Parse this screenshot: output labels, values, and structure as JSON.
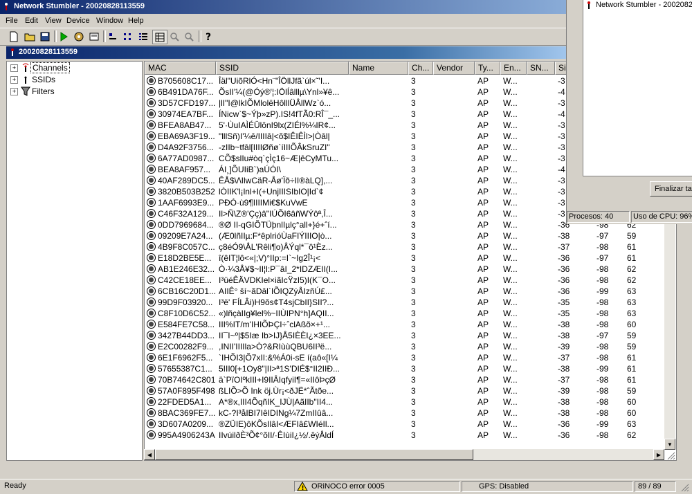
{
  "window": {
    "title": "Network Stumbler - 20020828113559"
  },
  "menu": [
    "File",
    "Edit",
    "View",
    "Device",
    "Window",
    "Help"
  ],
  "child": {
    "title": "20020828113559"
  },
  "tree": [
    {
      "label": "Channels",
      "icon": "antenna-icon",
      "selected": true
    },
    {
      "label": "SSIDs",
      "icon": "antenna-icon",
      "selected": false
    },
    {
      "label": "Filters",
      "icon": "filter-icon",
      "selected": false
    }
  ],
  "columns": [
    "MAC",
    "SSID",
    "Name",
    "Ch...",
    "Vendor",
    "Ty...",
    "En...",
    "SN...",
    "Si"
  ],
  "rows": [
    [
      "B705608C17...",
      "Îäl\"UiõRlÓ<Hn¨\"ÎÖllJfã`úl×˜'I...",
      "",
      "3",
      "",
      "AP",
      "W...",
      "",
      "-3",
      "",
      ""
    ],
    [
      "6B491DA76F...",
      "ÕsII'¼(@Óý®'¦:IÖlÍâlllµ\\Ynl»¥ê...",
      "",
      "3",
      "",
      "AP",
      "W...",
      "",
      "-4",
      "",
      ""
    ],
    [
      "3D57CFD197...",
      "|lI\"I@lkIÕMlolëHôlllÜÂllWz`ó...",
      "",
      "3",
      "",
      "AP",
      "W...",
      "",
      "-3",
      "",
      ""
    ],
    [
      "30974EA7BF...",
      "ÍNicw`$~Ýþ»zP).IS!4fTÃ0:RÎ¯_...",
      "",
      "3",
      "",
      "AP",
      "W...",
      "",
      "-4",
      "",
      ""
    ],
    [
      "BFEA8AB47...",
      "5'·ÙuIAÌÉÜlônI9lx(ZIÉl%¼IR¢...",
      "",
      "3",
      "",
      "AP",
      "W...",
      "",
      "-3",
      "",
      ""
    ],
    [
      "EBA69A3F19...",
      "\"lllSñ)I'¼ê/IIIIâ|<õ$IÊIÊÌl>|Òâl|",
      "",
      "3",
      "",
      "AP",
      "W...",
      "",
      "-3",
      "",
      ""
    ],
    [
      "D4A92F3756...",
      "-zIIb~tfâl[IIIIØñø`íIIIÕÂkSruZI\"",
      "",
      "3",
      "",
      "AP",
      "W...",
      "",
      "-3",
      "",
      ""
    ],
    [
      "6A77AD0987...",
      "CÕ$slIu#òq`çÌç16~Æ|êCyMTu...",
      "",
      "3",
      "",
      "AP",
      "W...",
      "",
      "-3",
      "",
      ""
    ],
    [
      "BEA8AF957...",
      "ÁI¸]ÕUIiB`)aÚÓI\\",
      "",
      "3",
      "",
      "AP",
      "W...",
      "",
      "-4",
      "",
      ""
    ],
    [
      "40AF289DC5...",
      "ÊÅ$\\/\\IlwCäR-Åø'Ïõ÷II®àLQ],...",
      "",
      "3",
      "",
      "AP",
      "W...",
      "",
      "-3",
      "",
      ""
    ],
    [
      "3820B503B252",
      "lÒIIK'l¡lnl+I(+UnjIIISIbIO|Id`¢",
      "",
      "3",
      "",
      "AP",
      "W...",
      "",
      "-3",
      "",
      ""
    ],
    [
      "1AAF6993E9...",
      "PÐÓ·ù9¶IIIIMi€$KuVwE",
      "",
      "3",
      "",
      "AP",
      "W...",
      "",
      "-3",
      "",
      ""
    ],
    [
      "C46F32A129...",
      "Il>Ñ\\Z®'Çç)â\"IÚÕI6âñWÝôª,Î...",
      "",
      "3",
      "",
      "AP",
      "W...",
      "",
      "-3",
      "",
      ""
    ],
    [
      "0DD7969684...",
      "®Ø II-qGIÕTÜþnlIµlç°all+}é+ˆí...",
      "",
      "3",
      "",
      "AP",
      "W...",
      "",
      "-36",
      "-98",
      "62"
    ],
    [
      "09209E7A24...",
      "(Æ0lñIIµ:F*êplrióÙaFIÝIIIO|ò...",
      "",
      "3",
      "",
      "AP",
      "W...",
      "",
      "-38",
      "-97",
      "59"
    ],
    [
      "4B9F8C057C...",
      "ç8éÓ9\\ÅL'Rêli¶o)ÂÝql*¯ô¹Èz...",
      "",
      "3",
      "",
      "AP",
      "W...",
      "",
      "-37",
      "-98",
      "61"
    ],
    [
      "E18D2BE5E...",
      "î(êIT¦lô<«|;V)°IIp:=I`~Ig2Î¹¡<",
      "",
      "3",
      "",
      "AP",
      "W...",
      "",
      "-36",
      "-97",
      "61"
    ],
    [
      "AB1E246E32...",
      "Ò·¼3Å¥$~II¦l:P¯âI_2*IDZÆII(I...",
      "",
      "3",
      "",
      "AP",
      "W...",
      "",
      "-36",
      "-98",
      "62"
    ],
    [
      "C42CE18EE...",
      "I³üéÊÄVDKIel×iãIcŸzI5)I(K¯O...",
      "",
      "3",
      "",
      "AP",
      "W...",
      "",
      "-36",
      "-98",
      "62"
    ],
    [
      "6CB16C20D1...",
      "AIIÊ° ší~ãDâl`IÕIQZýÅIzñÚ£...",
      "",
      "3",
      "",
      "AP",
      "W...",
      "",
      "-36",
      "-99",
      "63"
    ],
    [
      "99D9F03920...",
      "I³ë' FÍLÂi)H9õs¢T4sjCbII}SII?...",
      "",
      "3",
      "",
      "AP",
      "W...",
      "",
      "-35",
      "-98",
      "63"
    ],
    [
      "C8F10D6C52...",
      "«)lñçàIIg¥lel%~IIÙIPN°h]AQII...",
      "",
      "3",
      "",
      "AP",
      "W...",
      "",
      "-35",
      "-98",
      "63"
    ],
    [
      "E584FE7C58...",
      "III%IT/m'IHIÕÞÇI÷ˆclAßõ×+¹...",
      "",
      "3",
      "",
      "AP",
      "W...",
      "",
      "-38",
      "-98",
      "60"
    ],
    [
      "3427B44DD3...",
      "II¯I~º|$5Iæ Ib>IJ}Å5IÈÈI¿×3EE...",
      "",
      "3",
      "",
      "AP",
      "W...",
      "",
      "-38",
      "-97",
      "59"
    ],
    [
      "E2C00282F9...",
      ",INII'IIIIla>Ò?&RIùùQBU6II³ë...",
      "",
      "3",
      "",
      "AP",
      "W...",
      "",
      "-39",
      "-98",
      "59"
    ],
    [
      "6E1F6962F5...",
      "`IHÕI3|Õ7xII:&%Á0i-sE í(aô«[I¼",
      "",
      "3",
      "",
      "AP",
      "W...",
      "",
      "-37",
      "-98",
      "61"
    ],
    [
      "57655387C1...",
      "5III0[+1Oy8\"|II>ª1S'DIÉ$°II2IIÐ...",
      "",
      "3",
      "",
      "AP",
      "W...",
      "",
      "-38",
      "-99",
      "61"
    ],
    [
      "70B74642C801",
      "ä`PïOIºkIII+I9IIÂIqfyiI¶=«IIôÞçØ",
      "",
      "3",
      "",
      "AP",
      "W...",
      "",
      "-37",
      "-98",
      "61"
    ],
    [
      "57A0F895F498",
      "ßLIÕ>Õ Ink öj.Ùr¡<ðJË*ˆÃtõe...",
      "",
      "3",
      "",
      "AP",
      "W...",
      "",
      "-39",
      "-98",
      "59"
    ],
    [
      "22FDED5A1...",
      "A*®x,III4ÕqñIK_IJÙ|AãIIb\"II4...",
      "",
      "3",
      "",
      "AP",
      "W...",
      "",
      "-38",
      "-98",
      "60"
    ],
    [
      "8BAC369FE7...",
      "kC-?I³åIBI7IêIDINg¼7ZmIIûâ...",
      "",
      "3",
      "",
      "AP",
      "W...",
      "",
      "-38",
      "-98",
      "60"
    ],
    [
      "3D607A0209...",
      "®ZÜIE)ôKÕsIlâI<ÆFIâ£WIéIl...",
      "",
      "3",
      "",
      "AP",
      "W...",
      "",
      "-36",
      "-99",
      "63"
    ],
    [
      "995A4906243A",
      "IIvúilðÈ³Õ¢°õII/·ÊIùiI¿½/.êýÅldÍ",
      "",
      "3",
      "",
      "AP",
      "W...",
      "",
      "-36",
      "-98",
      "62"
    ]
  ],
  "status": {
    "ready": "Ready",
    "error": "ORiNOCO error 0005",
    "gps": "GPS: Disabled",
    "count": "89 / 89"
  },
  "taskmanager": {
    "title": "Network Stumbler - 20020828113559",
    "finish_button": "Finalizar tarea",
    "processes": "Procesos: 40",
    "cpu": "Uso de CPU: 96%"
  }
}
